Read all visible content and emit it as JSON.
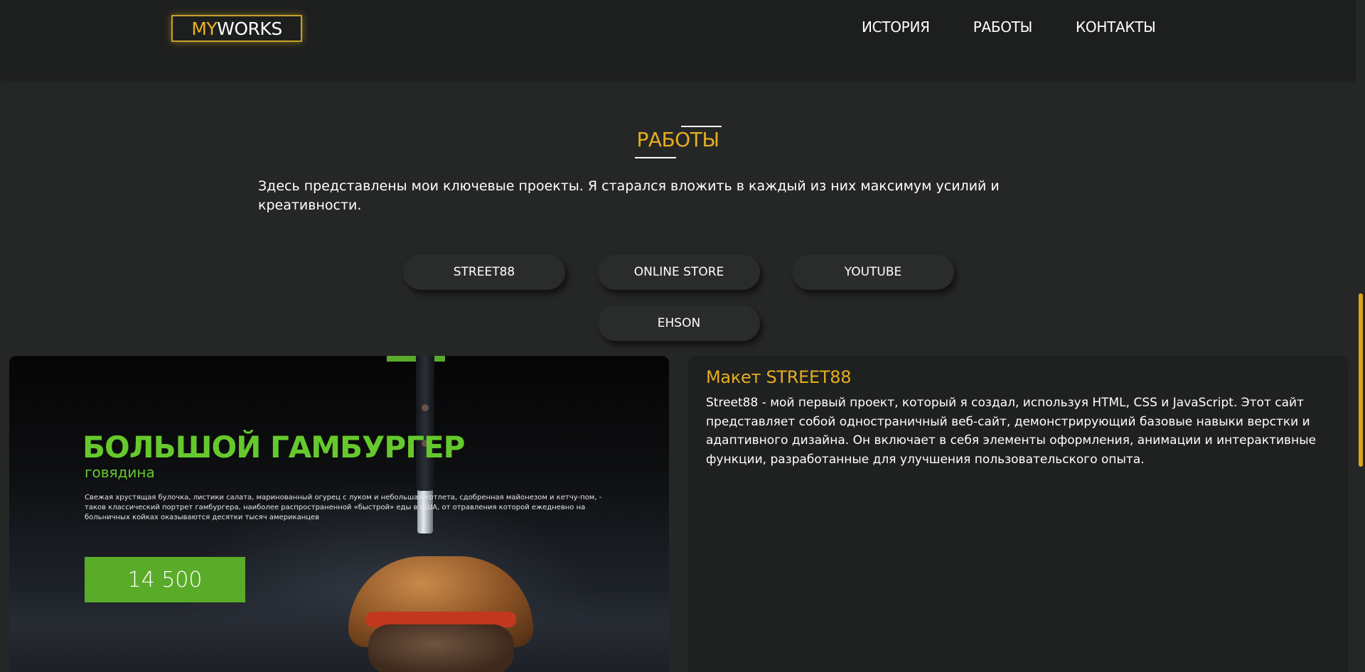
{
  "header": {
    "logo": {
      "part1": "MY",
      "part2": "WORKS"
    },
    "nav": [
      {
        "label": "ИСТОРИЯ"
      },
      {
        "label": "РАБОТЫ"
      },
      {
        "label": "КОНТАКТЫ"
      }
    ]
  },
  "section": {
    "title": "РАБОТЫ",
    "intro": "Здесь представлены мои ключевые проекты. Я старался вложить в каждый из них максимум усилий и креативности."
  },
  "filters": [
    {
      "label": "STREET88"
    },
    {
      "label": "ONLINE STORE"
    },
    {
      "label": "YOUTUBE"
    },
    {
      "label": "EHSON"
    }
  ],
  "project": {
    "image": {
      "title": "БОЛЬШОЙ ГАМБУРГЕР",
      "subtitle": "говядина",
      "description": "Свежая хрустящая булочка, листики салата, маринованный огурец с луком и небольшая котлета, сдобренная майонезом и кетчу-пом, - таков классический портрет гамбургера, наиболее распространенной «быстрой» еды в США, от отравления которой ежедневно на больничных койках оказываются десятки тысяч американцев",
      "price": "14 500"
    },
    "info": {
      "title": "Макет STREET88",
      "description": "Street88 - мой первый проект, который я создал, используя HTML, CSS и JavaScript. Этот сайт представляет собой одностраничный веб-сайт, демонстрирующий базовые навыки верстки и адаптивного дизайна. Он включает в себя элементы оформления, анимации и интерактивные функции, разработанные для улучшения пользовательского опыта."
    }
  },
  "colors": {
    "background": "#252726",
    "header_bg": "#1d1f1e",
    "accent_gold": "#e6ad1f",
    "accent_green": "#65c92d",
    "price_green": "#5aab2a"
  }
}
